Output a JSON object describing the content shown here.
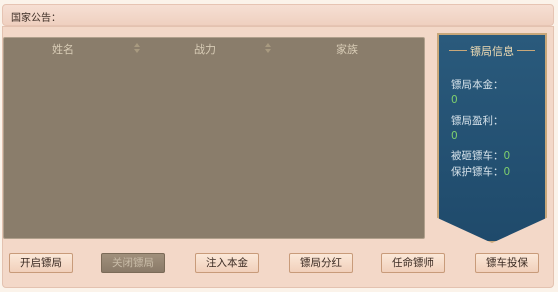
{
  "announcement": {
    "label": "国家公告："
  },
  "list": {
    "columns": [
      "姓名",
      "战力",
      "家族"
    ]
  },
  "info_panel": {
    "title": "镖局信息",
    "capital_label": "镖局本金：",
    "capital_value": "0",
    "profit_label": "镖局盈利：",
    "profit_value": "0",
    "robbed_label": "被砸镖车：",
    "robbed_value": "0",
    "protected_label": "保护镖车：",
    "protected_value": "0"
  },
  "buttons": [
    {
      "label": "开启镖局",
      "enabled": true
    },
    {
      "label": "关闭镖局",
      "enabled": false
    },
    {
      "label": "注入本金",
      "enabled": true
    },
    {
      "label": "镖局分红",
      "enabled": true
    },
    {
      "label": "任命镖师",
      "enabled": true
    },
    {
      "label": "镖车投保",
      "enabled": true
    }
  ]
}
